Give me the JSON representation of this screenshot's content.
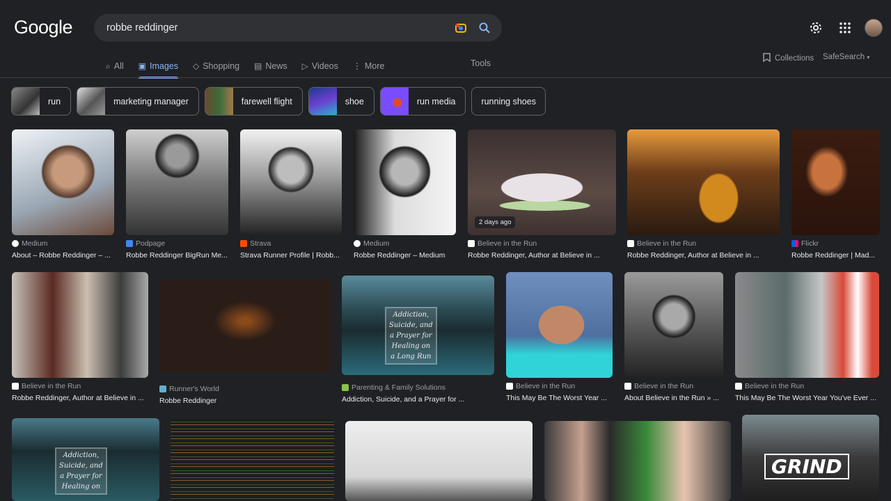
{
  "logo": "Google",
  "search": {
    "query": "robbe reddinger"
  },
  "nav": {
    "items": [
      {
        "label": "All",
        "icon": "search-icon",
        "active": false
      },
      {
        "label": "Images",
        "icon": "image-icon",
        "active": true
      },
      {
        "label": "Shopping",
        "icon": "tag-icon",
        "active": false
      },
      {
        "label": "News",
        "icon": "newspaper-icon",
        "active": false
      },
      {
        "label": "Videos",
        "icon": "play-icon",
        "active": false
      },
      {
        "label": "More",
        "icon": "more-vert-icon",
        "active": false
      }
    ],
    "tools": "Tools",
    "collections": "Collections",
    "safesearch": "SafeSearch"
  },
  "chips": [
    "run",
    "marketing manager",
    "farewell flight",
    "shoe",
    "run media",
    "running shoes"
  ],
  "results": [
    {
      "source": "Medium",
      "title": "About – Robbe Reddinger – ..."
    },
    {
      "source": "Podpage",
      "title": "Robbe Reddinger BigRun Me..."
    },
    {
      "source": "Strava",
      "title": "Strava Runner Profile | Robb..."
    },
    {
      "source": "Medium",
      "title": "Robbe Reddinger – Medium"
    },
    {
      "source": "Believe in the Run",
      "title": "Robbe Reddinger, Author at Believe in ...",
      "badge": "2 days ago"
    },
    {
      "source": "Believe in the Run",
      "title": "Robbe Reddinger, Author at Believe in ..."
    },
    {
      "source": "Flickr",
      "title": "Robbe Reddinger | Mad..."
    },
    {
      "source": "Believe in the Run",
      "title": "Robbe Reddinger, Author at Believe in ..."
    },
    {
      "source": "Runner's World",
      "title": "Robbe Reddinger"
    },
    {
      "source": "Parenting & Family Solutions",
      "title": "Addiction, Suicide, and a Prayer for ...",
      "overlay": "Addiction,\nSuicide, and\na Prayer for\nHealing on\na Long Run"
    },
    {
      "source": "Believe in the Run",
      "title": "This May Be The Worst Year ..."
    },
    {
      "source": "Believe in the Run",
      "title": "About Believe in the Run » ..."
    },
    {
      "source": "Believe in the Run",
      "title": "This May Be The Worst Year You've Ever ..."
    }
  ],
  "row3": {
    "overlay": "Addiction,\nSuicide, and\na Prayer for\nHealing on",
    "grind": "GRIND"
  },
  "colors": {
    "background": "#202124",
    "accent": "#8ab4f8",
    "searchbox": "#303134"
  }
}
